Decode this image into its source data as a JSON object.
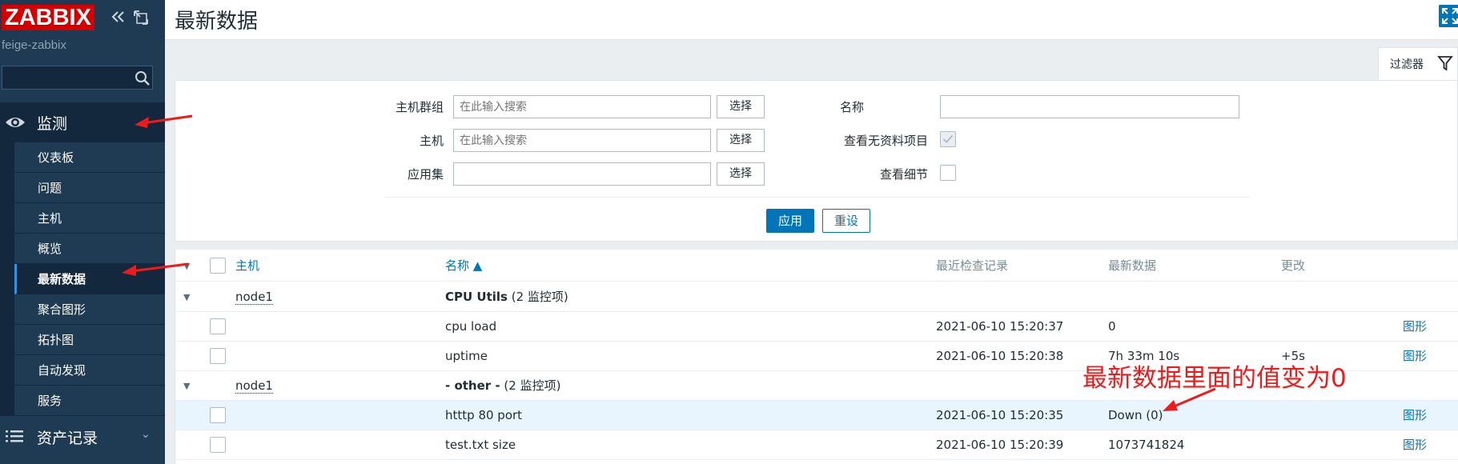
{
  "sidebar": {
    "logo": "ZABBIX",
    "server_name": "feige-zabbix",
    "search_placeholder": "",
    "monitoring": {
      "label": "监测",
      "items": [
        {
          "label": "仪表板"
        },
        {
          "label": "问题"
        },
        {
          "label": "主机"
        },
        {
          "label": "概览"
        },
        {
          "label": "最新数据"
        },
        {
          "label": "聚合图形"
        },
        {
          "label": "拓扑图"
        },
        {
          "label": "自动发现"
        },
        {
          "label": "服务"
        }
      ]
    },
    "inventory": {
      "label": "资产记录"
    }
  },
  "header": {
    "title": "最新数据"
  },
  "filter": {
    "tab_label": "过滤器",
    "host_groups_label": "主机群组",
    "host_groups_placeholder": "在此输入搜索",
    "hosts_label": "主机",
    "hosts_placeholder": "在此输入搜索",
    "application_label": "应用集",
    "application_value": "",
    "select_label": "选择",
    "name_label": "名称",
    "name_value": "",
    "show_items_without_data_label": "查看无资料项目",
    "show_details_label": "查看细节",
    "apply_label": "应用",
    "reset_label": "重设"
  },
  "table": {
    "headers": {
      "host": "主机",
      "name": "名称 ▲",
      "last_check": "最近检查记录",
      "last_value": "最新数据",
      "change": "更改"
    },
    "groups": [
      {
        "host": "node1",
        "name": "CPU Utils",
        "count": "(2 监控项)",
        "items": [
          {
            "name": "cpu load",
            "last_check": "2021-06-10 15:20:37",
            "last_value": "0",
            "change": "",
            "graph": "图形"
          },
          {
            "name": "uptime",
            "last_check": "2021-06-10 15:20:38",
            "last_value": "7h 33m 10s",
            "change": "+5s",
            "graph": "图形"
          }
        ]
      },
      {
        "host": "node1",
        "name": "- other -",
        "count": "(2 监控项)",
        "items": [
          {
            "name": "htttp 80 port",
            "last_check": "2021-06-10 15:20:35",
            "last_value": "Down (0)",
            "change": "",
            "graph": "图形"
          },
          {
            "name": "test.txt size",
            "last_check": "2021-06-10 15:20:39",
            "last_value": "1073741824",
            "change": "",
            "graph": "图形"
          }
        ]
      }
    ]
  },
  "annotation": {
    "text": "最新数据里面的值变为0",
    "color": "#ee1b1b"
  },
  "colors": {
    "sidebar": "#1f3b53",
    "sidebar_dark": "#13283c",
    "accent": "#0275b8",
    "logo": "#d40000"
  }
}
